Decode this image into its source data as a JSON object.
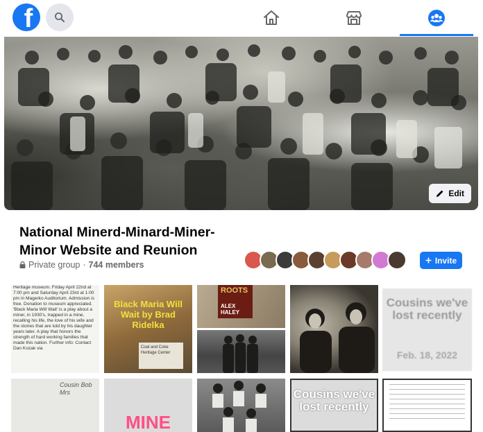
{
  "nav": {
    "logo_letter": "f",
    "tabs": [
      "home",
      "marketplace",
      "groups"
    ],
    "active_tab": "groups"
  },
  "cover": {
    "edit_label": "Edit"
  },
  "group": {
    "title": "National Minerd-Minard-Miner-Minor Website and Reunion",
    "privacy": "Private group",
    "separator": "·",
    "members": "744 members",
    "invite_label": "Invite"
  },
  "member_avatar_colors": [
    "#d9574c",
    "#7a6a4f",
    "#3b3b3b",
    "#8a5a3c",
    "#5c4030",
    "#c79b5a",
    "#6b3a2a",
    "#a67b6b",
    "#d27ad3",
    "#4a3a30"
  ],
  "photos": {
    "t1_text": "Heritage museum. Friday April 22nd at 7:00 pm and Saturday April 23rd at 1:00 pm in Magerko Auditorium. Admission is free. Donation to museum appreciated. 'Black Maria Will Wait' is a play about a miner, in 1930's, trapped in a mine, recalling his life, the love of his wife and the stories that are told by his daughter years later. A play that honors the strength of hard working families that made this nation. Further info: Contact Dan Kozak via",
    "t2_title": "Black Maria Will Wait by Brad Ridelka",
    "t2_sub": "Coal and Coke Heritage Center",
    "t3_book_title": "ROOTS",
    "t3_book_author": "ALEX HALEY",
    "t5_text": "Cousins we've lost recently",
    "t5_date": "Feb. 18, 2022",
    "t6_text": "Cousin Bob Mrs",
    "t7_text": "MINE",
    "t9_text": "Cousins we've lost recently"
  },
  "colors": {
    "brand": "#1877f2",
    "secondary_text": "#65676b"
  }
}
